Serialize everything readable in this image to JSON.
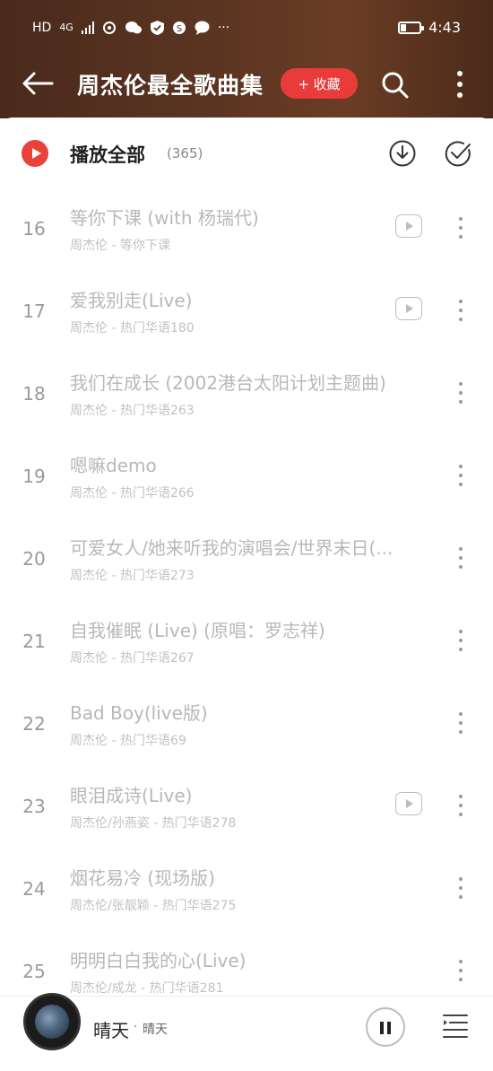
{
  "status_bar": {
    "left_icons": [
      "HD",
      "4G",
      "signal-icon",
      "data-saver-icon",
      "wechat-icon",
      "shield-icon",
      "app-icon",
      "message-icon",
      "···"
    ],
    "battery_fraction": 0.3,
    "time": "4:43"
  },
  "header": {
    "title": "周杰伦最全歌曲集",
    "collect_label": "+ 收藏"
  },
  "play_all": {
    "label": "播放全部",
    "count": "(365)"
  },
  "songs": [
    {
      "num": "16",
      "title": "等你下课 (with 杨瑞代)",
      "subtitle": "周杰伦 - 等你下课",
      "has_mv": true
    },
    {
      "num": "17",
      "title": "爱我别走(Live)",
      "subtitle": "周杰伦 - 热门华语180",
      "has_mv": true
    },
    {
      "num": "18",
      "title": "我们在成长 (2002港台太阳计划主题曲)",
      "subtitle": "周杰伦 - 热门华语263",
      "has_mv": false
    },
    {
      "num": "19",
      "title": "嗯嘛demo",
      "subtitle": "周杰伦 - 热门华语266",
      "has_mv": false
    },
    {
      "num": "20",
      "title": "可爱女人/她来听我的演唱会/世界末日(...",
      "subtitle": "周杰伦 - 热门华语273",
      "has_mv": false
    },
    {
      "num": "21",
      "title": "自我催眠 (Live) (原唱：罗志祥)",
      "subtitle": "周杰伦 - 热门华语267",
      "has_mv": false
    },
    {
      "num": "22",
      "title": "Bad Boy(live版)",
      "subtitle": "周杰伦 - 热门华语69",
      "has_mv": false
    },
    {
      "num": "23",
      "title": "眼泪成诗(Live)",
      "subtitle": "周杰伦/孙燕姿 - 热门华语278",
      "has_mv": true
    },
    {
      "num": "24",
      "title": "烟花易冷 (现场版)",
      "subtitle": "周杰伦/张靓颖 - 热门华语275",
      "has_mv": false
    },
    {
      "num": "25",
      "title": "明明白白我的心(Live)",
      "subtitle": "周杰伦/成龙 - 热门华语281",
      "has_mv": false
    }
  ],
  "now_playing": {
    "title": "晴天",
    "separator": "·",
    "artist": "晴天"
  },
  "colors": {
    "header_bg": "#5c3522",
    "accent_red": "#ea3b3b"
  }
}
